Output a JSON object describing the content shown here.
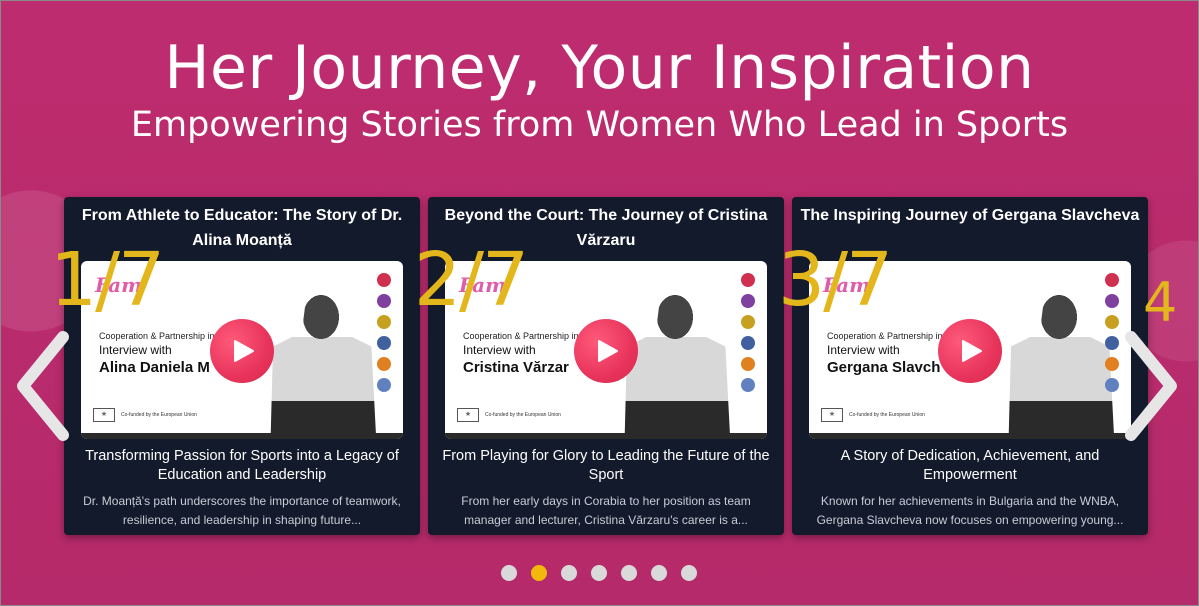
{
  "header": {
    "title": "Her Journey, Your Inspiration",
    "subtitle": "Empowering Stories from Women Who Lead in Sports"
  },
  "colors": {
    "background": "#b82b6b",
    "card": "#121a2c",
    "counter": "#e3b71c",
    "play": "#e8345c",
    "dot_active": "#f0b90b",
    "dot_inactive": "#d9d9d9"
  },
  "cards": [
    {
      "title": "From Athlete to Educator: The Story of Dr. Alina Moanță",
      "counter": "1/7",
      "thumb": {
        "logo": "Fam",
        "coop": "Cooperation & Partnership in Sp",
        "interview": "Interview with",
        "name": "Alina Daniela M",
        "eu": "Co-funded by the European Union"
      },
      "heading": "Transforming Passion for Sports into a Legacy of Education and Leadership",
      "description": "Dr. Moanță's path underscores the importance of teamwork, resilience, and leadership in shaping future..."
    },
    {
      "title": "Beyond the Court: The Journey of Cristina Vărzaru",
      "counter": "2/7",
      "thumb": {
        "logo": "Fam",
        "coop": "Cooperation & Partnership in Sp",
        "interview": "Interview with",
        "name": "Cristina Vărzar",
        "eu": "Co-funded by the European Union"
      },
      "heading": "From Playing for Glory to Leading the Future of the Sport",
      "description": "From her early days in Corabia to her position as team manager and lecturer, Cristina Vărzaru's career is a..."
    },
    {
      "title": "The Inspiring Journey of Gergana Slavcheva",
      "counter": "3/7",
      "thumb": {
        "logo": "Fam",
        "coop": "Cooperation & Partnership in Sp",
        "interview": "Interview with",
        "name": "Gergana Slavch",
        "eu": "Co-funded by the European Union"
      },
      "heading": "A Story of Dedication, Achievement, and Empowerment",
      "description": "Known for her achievements in Bulgaria and the WNBA, Gergana Slavcheva now focuses on empowering young..."
    }
  ],
  "next_peek_counter": "4",
  "pagination": {
    "total": 7,
    "active_index": 1
  },
  "icons": {
    "prev": "chevron-left-icon",
    "next": "chevron-right-icon",
    "play": "play-icon"
  }
}
